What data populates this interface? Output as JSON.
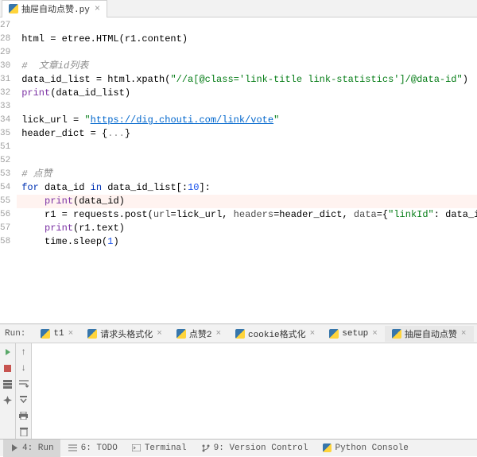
{
  "editorTab": {
    "name": "抽屉自动点赞.py"
  },
  "gutter": {
    "start": 27,
    "end": 58,
    "breakpointLine": 55,
    "highlightLine": 55
  },
  "code": {
    "l28": {
      "a": "html = etree.HTML(r1.content)"
    },
    "l30": {
      "a": "#  文章id列表"
    },
    "l31": {
      "a": "data_id_list = html.xpath(",
      "b": "\"//a[@class='link-title link-statistics']/@data-id\"",
      "c": ")"
    },
    "l32": {
      "a": "print",
      "b": "(data_id_list)"
    },
    "l34": {
      "a": "lick_url = ",
      "b": "\"",
      "c": "https://dig.chouti.com/link/vote",
      "d": "\""
    },
    "l35": {
      "a": "header_dict = {",
      "b": "...",
      "c": "}"
    },
    "l53": {
      "a": "# 点赞"
    },
    "l54": {
      "a": "for",
      "b": " data_id ",
      "c": "in",
      "d": " data_id_list[:",
      "e": "10",
      "f": "]:"
    },
    "l55": {
      "a": "print",
      "b": "(data_id)"
    },
    "l56": {
      "a": "r1 = requests.post(",
      "b": "url",
      "c": "=lick_url, ",
      "d": "headers",
      "e": "=header_dict, ",
      "f": "data",
      "g": "={",
      "h": "\"linkId\"",
      "i": ": data_id})"
    },
    "l57": {
      "a": "print",
      "b": "(r1.text)"
    },
    "l58": {
      "a": "time.sleep(",
      "b": "1",
      "c": ")"
    }
  },
  "runPanel": {
    "label": "Run:",
    "tabs": [
      "t1",
      "请求头格式化",
      "点赞2",
      "cookie格式化",
      "setup",
      "抽屉自动点赞"
    ],
    "activeIndex": 5
  },
  "statusBar": {
    "run": "4: Run",
    "todo": "6: TODO",
    "terminal": "Terminal",
    "vcs": "9: Version Control",
    "pyconsole": "Python Console"
  }
}
